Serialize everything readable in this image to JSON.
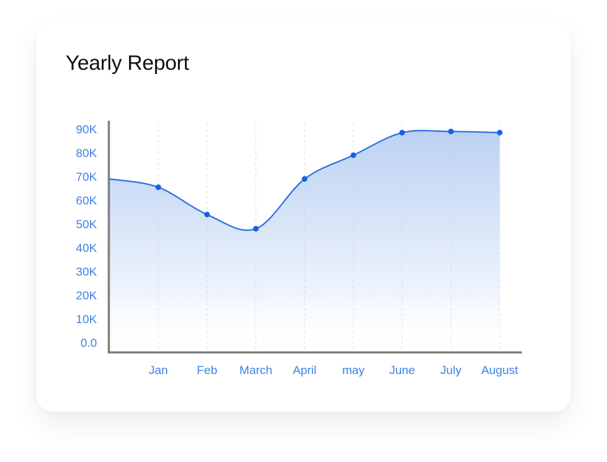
{
  "card": {
    "title": "Yearly Report"
  },
  "colors": {
    "accent": "#1a66e0",
    "line": "#2a6fdc",
    "point": "#1561e6",
    "tick_label": "#3b82e6",
    "axis": "#7a7a7a",
    "grid": "#e6e6e6",
    "fill_top": "#b8cff2",
    "fill_bottom": "#ffffff"
  },
  "chart_data": {
    "type": "area",
    "title": "Yearly Report",
    "xlabel": "",
    "ylabel": "",
    "categories": [
      "",
      "Jan",
      "Feb",
      "March",
      "April",
      "may",
      "June",
      "July",
      "August"
    ],
    "x_tick_labels": [
      "Jan",
      "Feb",
      "March",
      "April",
      "may",
      "June",
      "July",
      "August"
    ],
    "y_tick_labels": [
      "0.0",
      "10K",
      "20K",
      "30K",
      "40K",
      "50K",
      "60K",
      "70K",
      "80K",
      "90K"
    ],
    "y_ticks": [
      0,
      10000,
      20000,
      30000,
      40000,
      50000,
      60000,
      70000,
      80000,
      90000
    ],
    "ylim": [
      0,
      90000
    ],
    "series": [
      {
        "name": "Yearly Report",
        "values": [
          69000,
          65500,
          54000,
          48000,
          69000,
          79000,
          88500,
          89000,
          88500
        ],
        "markers_on": [
          "Jan",
          "Feb",
          "March",
          "April",
          "may",
          "June",
          "July",
          "August"
        ]
      }
    ],
    "grid": "vertical dashed lines at x categories",
    "legend": "none",
    "smooth": true
  }
}
